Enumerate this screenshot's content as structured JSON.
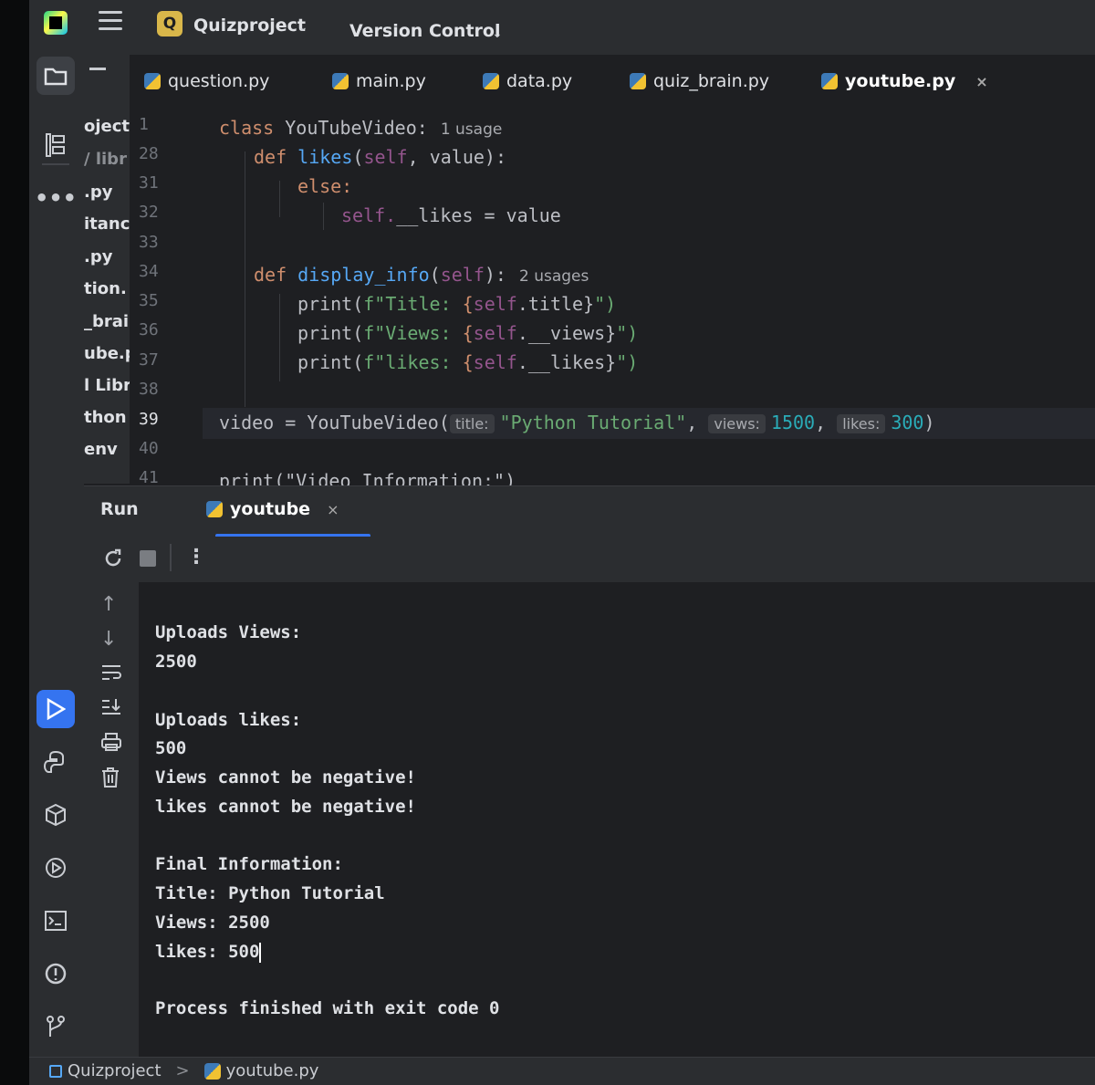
{
  "topbar": {
    "project_badge": "Q",
    "project_name": "Quizproject",
    "version_control": "Version Control"
  },
  "project_pane_fragments": [
    "oject",
    "/ libr",
    ".py",
    "itanc",
    ".py",
    "tion.",
    "_brair",
    "ube.p",
    "l Libr",
    "thon",
    "env"
  ],
  "tabs": [
    {
      "label": "question.py"
    },
    {
      "label": "main.py"
    },
    {
      "label": "data.py"
    },
    {
      "label": "quiz_brain.py"
    },
    {
      "label": "youtube.py",
      "close": "×"
    }
  ],
  "editor": {
    "line_numbers": [
      "1",
      "28",
      "31",
      "32",
      "33",
      "34",
      "35",
      "36",
      "37",
      "38",
      "39",
      "40",
      "41"
    ],
    "hints": {
      "class_usage": "1 usage",
      "display_usage": "2 usages",
      "inlay_title": "title:",
      "inlay_views": "views:",
      "inlay_likes": "likes:"
    },
    "tokens": {
      "class_kw": "class",
      "class_name": "YouTubeVideo:",
      "def_kw": "def",
      "likes_fn": "likes",
      "likes_params_open": "(",
      "self_kw": "self",
      "likes_params_rest": ", value):",
      "else_kw": "else:",
      "self_likes": "self.",
      "likes_attr": "__likes = value",
      "display_fn": "display_info",
      "display_paren_open": "(",
      "display_paren_close": "):",
      "print1_a": "print(",
      "print1_b": "f\"Title: ",
      "print1_c": "{",
      "print1_d": ".title}",
      "print1_e": "\")",
      "print2_b": "f\"Views: ",
      "print2_d": ".__views}",
      "print3_b": "f\"likes: ",
      "print3_d": ".__likes}",
      "video_assign": "video = YouTubeVideo(",
      "video_title": "\"Python Tutorial\"",
      "comma": ",",
      "video_views": "1500",
      "video_likes": "300",
      "close_paren": ")",
      "line41": "print(\"Video Information:\")"
    }
  },
  "run_panel": {
    "title": "Run",
    "tab_label": "youtube",
    "tab_close": "×",
    "output": [
      "Uploads Views:",
      "2500",
      "Uploads likes:",
      "500",
      "Views cannot be negative!",
      "likes cannot be negative!",
      "Final Information:",
      "Title: Python Tutorial",
      "Views: 2500",
      "likes: 500",
      "Process finished with exit code 0"
    ]
  },
  "statusbar": {
    "project": "Quizproject",
    "separator": ">",
    "file": "youtube.py"
  },
  "icons": {
    "strip": [
      "folder-icon",
      "structure-icon",
      "more-icon",
      "run-icon",
      "python-console-icon",
      "python-packages-icon",
      "services-icon",
      "terminal-icon",
      "problems-icon",
      "git-icon"
    ],
    "run_toolbar": [
      "rerun-icon",
      "stop-icon",
      "more-vertical-icon"
    ],
    "run_side": [
      "scroll-up-icon",
      "scroll-down-icon",
      "soft-wrap-icon",
      "scroll-to-end-icon",
      "print-icon",
      "clear-icon"
    ]
  },
  "colors": {
    "background": "#1e1f22",
    "panel": "#2b2d30",
    "accent": "#3574f0",
    "keyword": "#cf8e6d",
    "function": "#56a8f5",
    "self": "#94558d",
    "string": "#6aab73",
    "number": "#2aacb8"
  }
}
